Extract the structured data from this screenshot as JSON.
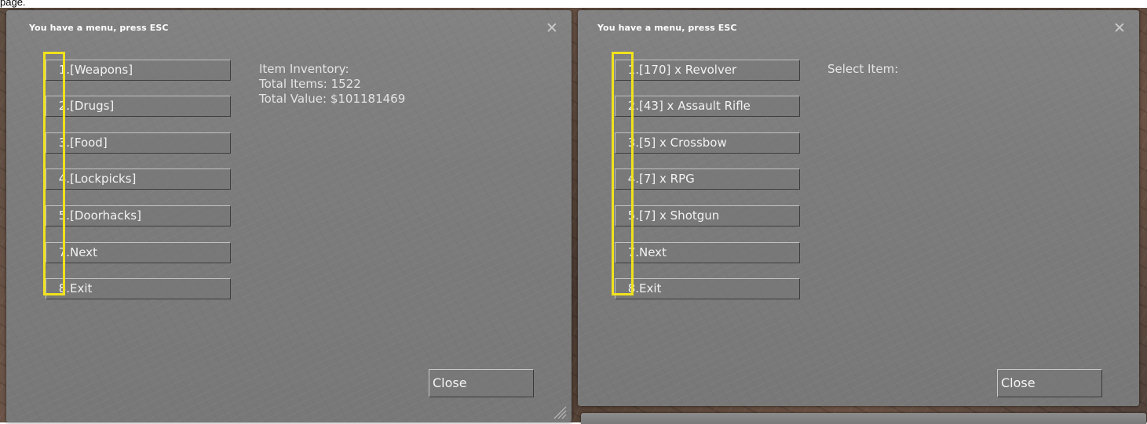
{
  "caption": "page.",
  "left_window": {
    "title": "You have a menu, press ESC",
    "menu_items": [
      {
        "num": "1.",
        "label": "[Weapons]"
      },
      {
        "num": "2.",
        "label": "[Drugs]"
      },
      {
        "num": "3.",
        "label": "[Food]"
      },
      {
        "num": "4.",
        "label": "[Lockpicks]"
      },
      {
        "num": "5.",
        "label": "[Doorhacks]"
      },
      {
        "num": "7.",
        "label": "Next"
      },
      {
        "num": "8.",
        "label": "Exit"
      }
    ],
    "info_lines": [
      "Item Inventory:",
      "Total Items: 1522",
      "Total Value: $101181469"
    ],
    "close_label": "Close"
  },
  "right_window": {
    "title": "You have a menu, press ESC",
    "menu_items": [
      {
        "num": "1.",
        "label": "[170] x Revolver"
      },
      {
        "num": "2.",
        "label": "[43] x Assault Rifle"
      },
      {
        "num": "3.",
        "label": "[5] x Crossbow"
      },
      {
        "num": "4.",
        "label": "[7] x RPG"
      },
      {
        "num": "5.",
        "label": "[7] x Shotgun"
      },
      {
        "num": "7.",
        "label": "Next"
      },
      {
        "num": "8.",
        "label": "Exit"
      }
    ],
    "info_lines": [
      "Select Item:"
    ],
    "close_label": "Close"
  },
  "colors": {
    "highlight": "#f0e21c",
    "panel": "#7e7e7e",
    "text": "#f2f2f2"
  },
  "icons": {
    "window_close": "close-icon",
    "resize": "resize-grip-icon"
  }
}
